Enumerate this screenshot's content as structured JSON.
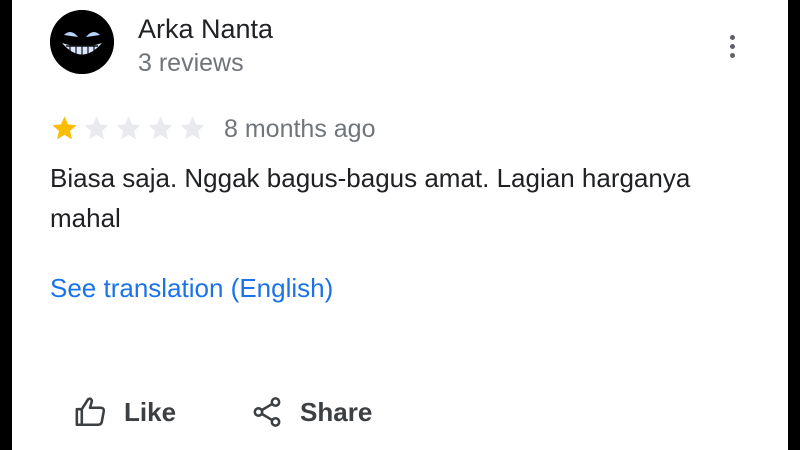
{
  "review": {
    "author_name": "Arka Nanta",
    "review_count": "3 reviews",
    "rating": 1,
    "max_rating": 5,
    "time_ago": "8 months ago",
    "text": "Biasa saja. Nggak bagus-bagus amat. Lagian harganya mahal",
    "translate_link": "See translation (English)"
  },
  "actions": {
    "like_label": "Like",
    "share_label": "Share"
  },
  "icons": {
    "avatar": "grinning-face-avatar",
    "more": "more-vert-icon",
    "like": "thumb-up-icon",
    "share": "share-icon"
  },
  "colors": {
    "star_filled": "#fbbc04",
    "star_empty": "#e8eaed",
    "link": "#1a73e8",
    "secondary_text": "#70757a"
  }
}
